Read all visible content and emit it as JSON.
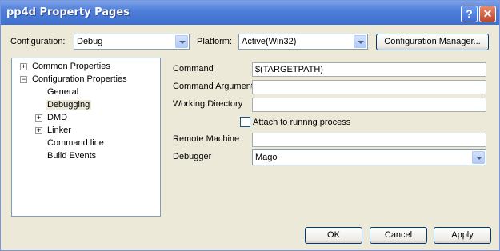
{
  "window": {
    "title": "pp4d Property Pages"
  },
  "titlebar": {
    "help": "?",
    "close": "✕"
  },
  "config": {
    "label": "Configuration:",
    "value": "Debug"
  },
  "platform": {
    "label": "Platform:",
    "value": "Active(Win32)"
  },
  "config_manager": {
    "label": "Configuration Manager..."
  },
  "tree": {
    "common": "Common Properties",
    "config_props": "Configuration Properties",
    "general": "General",
    "debugging": "Debugging",
    "dmd": "DMD",
    "linker": "Linker",
    "command_line": "Command line",
    "build_events": "Build Events"
  },
  "props": {
    "command": {
      "label": "Command",
      "value": "$(TARGETPATH)"
    },
    "command_args": {
      "label": "Command Arguments",
      "value": ""
    },
    "working_dir": {
      "label": "Working Directory",
      "value": ""
    },
    "attach": {
      "label": "Attach to runnng process",
      "checked": false
    },
    "remote_machine": {
      "label": "Remote Machine",
      "value": ""
    },
    "debugger": {
      "label": "Debugger",
      "value": "Mago"
    }
  },
  "buttons": {
    "ok": "OK",
    "cancel": "Cancel",
    "apply": "Apply"
  }
}
